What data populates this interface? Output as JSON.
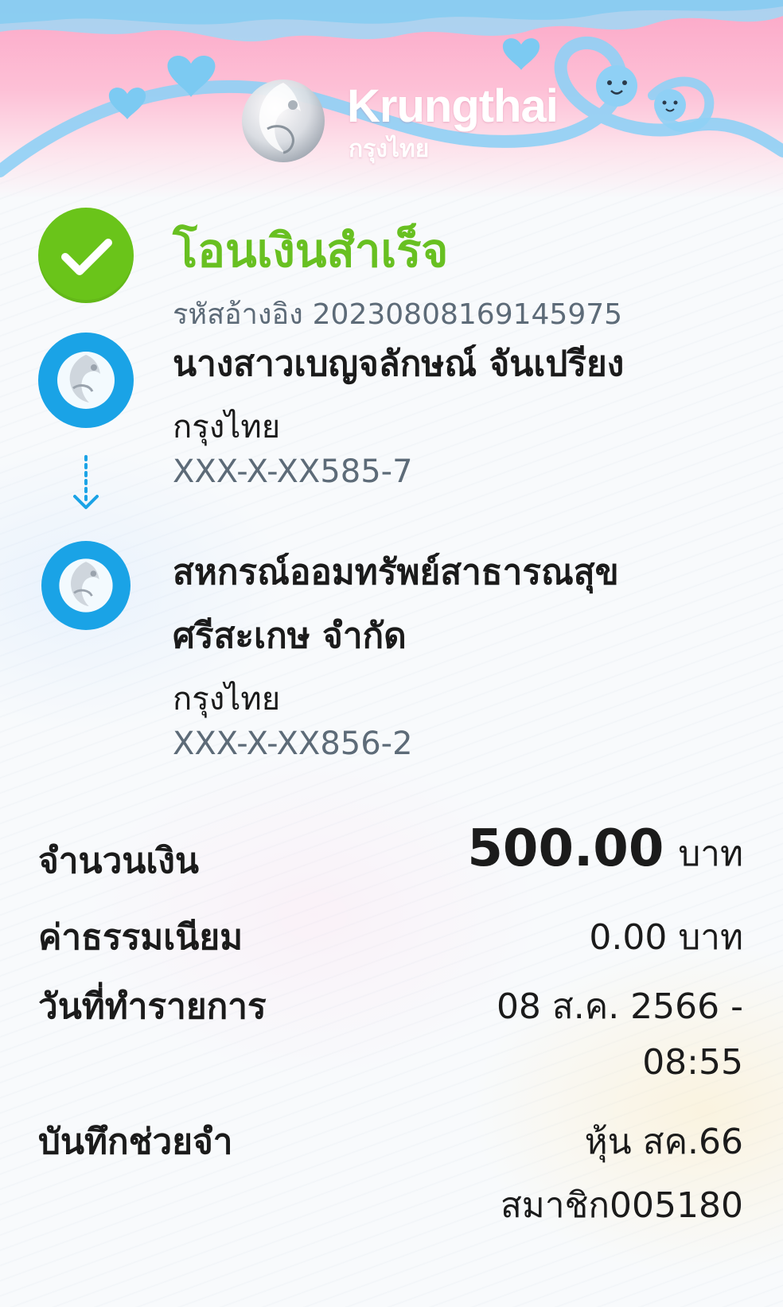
{
  "header": {
    "brand_en": "Krungthai",
    "brand_th": "กรุงไทย"
  },
  "status": {
    "title": "โอนเงินสำเร็จ",
    "ref_label": "รหัสอ้างอิง",
    "ref_code": "20230808169145975",
    "icon": "check-icon",
    "color": "#6ac41a"
  },
  "sender": {
    "name": "นางสาวเบญจลักษณ์ จันเปรียง",
    "bank": "กรุงไทย",
    "account": "XXX-X-XX585-7"
  },
  "receiver": {
    "name_line1": "สหกรณ์ออมทรัพย์สาธารณสุข",
    "name_line2": "ศรีสะเกษ จำกัด",
    "bank": "กรุงไทย",
    "account": "XXX-X-XX856-2"
  },
  "details": {
    "amount_label": "จำนวนเงิน",
    "amount_value": "500.00",
    "amount_unit": "บาท",
    "fee_label": "ค่าธรรมเนียม",
    "fee_value": "0.00 บาท",
    "date_label": "วันที่ทำรายการ",
    "date_line1": "08 ส.ค. 2566 -",
    "date_line2": "08:55",
    "memo_label": "บันทึกช่วยจำ",
    "memo_line1": "หุ้น สค.66",
    "memo_line2": "สมาชิก005180"
  },
  "colors": {
    "bank_blue": "#1aa3e6",
    "header_pink": "#fca7c7",
    "success_green": "#68c021"
  }
}
